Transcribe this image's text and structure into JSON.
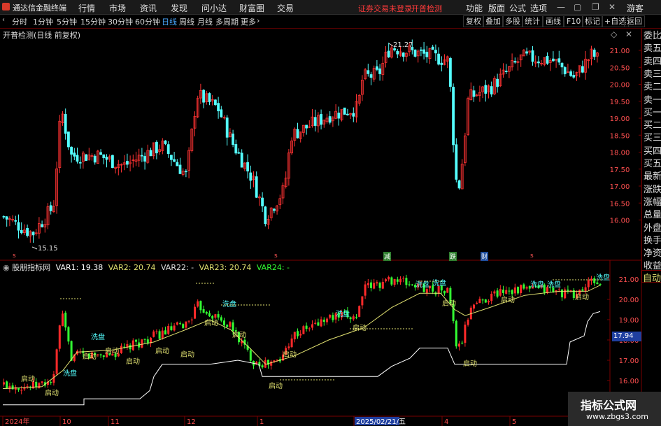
{
  "menubar": {
    "app_title": "通达信金融终端",
    "items": [
      "行情",
      "市场",
      "资讯",
      "发现",
      "问小达",
      "财富圈",
      "交易"
    ],
    "notice1": "证券交易未登录",
    "notice2": "开普检测",
    "right_items": [
      "功能",
      "版面",
      "公式",
      "选项"
    ],
    "guest": "游客"
  },
  "periodbar": {
    "periods": [
      "分时",
      "1分钟",
      "5分钟",
      "15分钟",
      "30分钟",
      "60分钟",
      "日线",
      "周线",
      "月线",
      "多周期",
      "更多"
    ],
    "active": "日线",
    "tools": [
      "复权",
      "叠加",
      "多股",
      "统计",
      "画线",
      "F10",
      "标记",
      "+自选",
      "返回"
    ]
  },
  "main_chart": {
    "title": "开普检测(日线 前复权)",
    "y_ticks": [
      "21.00",
      "20.50",
      "20.00",
      "19.50",
      "19.00",
      "18.50",
      "18.00",
      "17.50",
      "17.00",
      "16.50",
      "16.00"
    ],
    "high_label": "21.27",
    "low_label": "15.15",
    "markers": [
      "s",
      "s",
      "减",
      "跌",
      "财",
      "s"
    ]
  },
  "indicator": {
    "name": "股朋指标网",
    "var1": "VAR1: 19.38",
    "var2": "VAR2: 20.74",
    "var22": "VAR22: -",
    "var23": "VAR23: 20.74",
    "var24": "VAR24: -",
    "y_ticks": [
      "21.00",
      "20.00",
      "19.00",
      "18.00",
      "17.00",
      "16.00"
    ],
    "current_value": "17.94",
    "tags": [
      "洗盘",
      "启动"
    ]
  },
  "right_panel": {
    "items": [
      "委比",
      "卖五",
      "卖四",
      "卖三",
      "卖二",
      "卖一",
      "买一",
      "买二",
      "买三",
      "买四",
      "买五",
      "最新",
      "涨跌",
      "涨幅",
      "总量",
      "外盘",
      "换手",
      "净资",
      "收益"
    ],
    "auto": "自动"
  },
  "time_axis": {
    "labels": [
      "2024年",
      "10",
      "11",
      "12",
      "1",
      "2025/02/21/五",
      "4",
      "5"
    ]
  },
  "watermark": {
    "title": "指标公式网",
    "url": "www.zbgs3.com"
  },
  "colors": {
    "up": "#ff3333",
    "down": "#54ffff",
    "ind_up": "#ff2a2a",
    "ind_down": "#33ff33",
    "yellow_line": "#e0e070",
    "white_line": "#ffffff"
  }
}
